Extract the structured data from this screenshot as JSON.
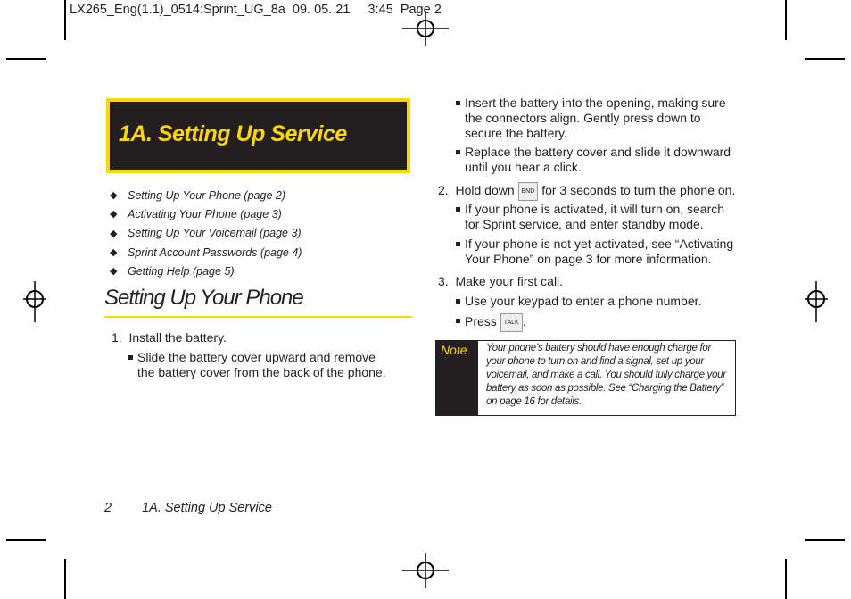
{
  "slug": "LX265_Eng(1.1)_0514:Sprint_UG_8a  09. 05. 21     3:45  Page 2",
  "section_title": "1A. Setting Up Service",
  "toc": [
    "Setting Up Your Phone (page 2)",
    "Activating Your Phone (page 3)",
    "Setting Up Your Voicemail (page 3)",
    "Sprint Account Passwords (page 4)",
    "Getting Help (page 5)"
  ],
  "heading": "Setting Up Your Phone",
  "step1": {
    "num": "1.",
    "text": "Install the battery.",
    "bullets": [
      "Slide the battery cover upward and remove the battery cover from the back of the phone.",
      "Insert the battery into the opening, making sure the connectors align. Gently press down to secure the battery.",
      "Replace the battery cover and slide it downward until you hear a click."
    ]
  },
  "step2": {
    "num": "2.",
    "pre": "Hold down",
    "key": "END",
    "post": "for 3 seconds to turn the phone on.",
    "bullets": [
      "If your phone is activated, it will turn on, search for Sprint service, and enter standby mode.",
      "If your phone is not yet activated, see “Activating Your Phone” on page 3 for more information."
    ]
  },
  "step3": {
    "num": "3.",
    "text": "Make your first call.",
    "bullet1": "Use your keypad to enter a phone number.",
    "press": "Press",
    "key": "TALK",
    "dot": "."
  },
  "note": {
    "label": "Note",
    "text": "Your phone’s battery should have enough charge for your phone to turn on and find a signal, set up your voicemail, and make a call. You should fully charge your battery as soon as possible. See “Charging the Battery” on page 16 for details."
  },
  "footer": {
    "page": "2",
    "section": "1A. Setting Up Service"
  },
  "colors": {
    "accent": "#ffd600",
    "dark": "#231f20"
  }
}
